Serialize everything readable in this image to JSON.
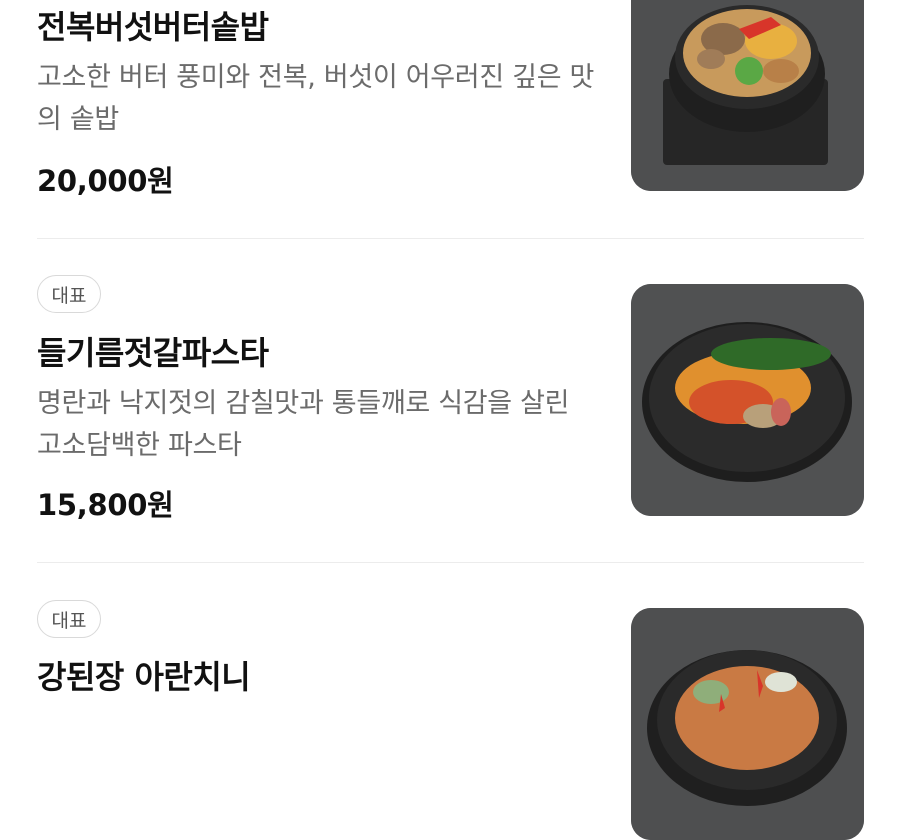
{
  "menu": {
    "items": [
      {
        "badge": "",
        "name": "전복버섯버터솥밥",
        "description": "고소한 버터 풍미와 전복, 버섯이 어우러진 깊은 맛의 솥밥",
        "price": "20,000원",
        "photo_icon": "food-photo-sotbap"
      },
      {
        "badge": "대표",
        "name": "들기름젓갈파스타",
        "description": "명란과 낙지젓의 감칠맛과 통들깨로 식감을 살린 고소담백한 파스타",
        "price": "15,800원",
        "photo_icon": "food-photo-pasta"
      },
      {
        "badge": "대표",
        "name": "강된장 아란치니",
        "description": "",
        "price": "",
        "photo_icon": "food-photo-arancini"
      }
    ]
  }
}
